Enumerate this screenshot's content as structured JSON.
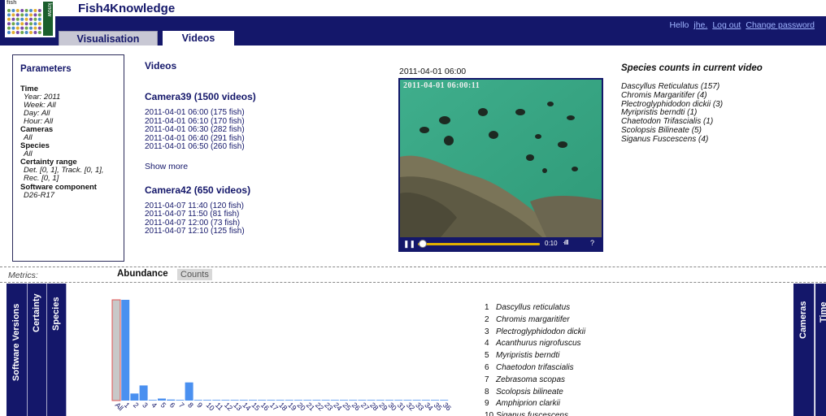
{
  "app": {
    "title": "Fish4Knowledge",
    "logo_top_text": "fish",
    "logo_side_text": "know"
  },
  "user": {
    "greeting": "Hello",
    "name": "jhe.",
    "logout": "Log out",
    "change_password": "Change password"
  },
  "tabs": [
    {
      "label": "Visualisation",
      "active": false
    },
    {
      "label": "Videos",
      "active": true
    }
  ],
  "parameters": {
    "title": "Parameters",
    "time_label": "Time",
    "year": "Year: 2011",
    "week": "Week: All",
    "day": "Day: All",
    "hour": "Hour: All",
    "cameras_label": "Cameras",
    "cameras_value": "All",
    "species_label": "Species",
    "species_value": "All",
    "certainty_label": "Certainty range",
    "certainty_line1": "Det. [0, 1], Track. [0, 1],",
    "certainty_line2": "Rec. [0, 1]",
    "software_label": "Software component",
    "software_value": "D26-R17"
  },
  "videos": {
    "title": "Videos",
    "show_more": "Show more",
    "cameras": [
      {
        "title": "Camera39 (1500 videos)",
        "items": [
          "2011-04-01 06:00 (175 fish)",
          "2011-04-01 06:10 (170 fish)",
          "2011-04-01 06:30 (282 fish)",
          "2011-04-01 06:40 (291 fish)",
          "2011-04-01 06:50 (260 fish)"
        ]
      },
      {
        "title": "Camera42 (650 videos)",
        "items": [
          "2011-04-07 11:40 (120 fish)",
          "2011-04-07 11:50 (81 fish)",
          "2011-04-07 12:00 (73 fish)",
          "2011-04-07 12:10 (125 fish)"
        ]
      }
    ]
  },
  "player": {
    "date": "2011-04-01 06:00",
    "overlay_timestamp": "2011-04-01 06:00:11",
    "time": "0:10",
    "progress": 0.02
  },
  "species_counts": {
    "title": "Species counts in current video",
    "items": [
      "Dascyllus Reticulatus (157)",
      "Chromis Margaritifer (4)",
      "Plectroglyphidodon dickii (3)",
      "Myripristis berndti (1)",
      "Chaetodon Trifascialis (1)",
      "Scolopsis Bilineate (5)",
      "Siganus Fuscescens (4)"
    ]
  },
  "metrics": {
    "label": "Metrics:",
    "tabs": [
      {
        "label": "Abundance",
        "active": true
      },
      {
        "label": "Counts",
        "active": false
      }
    ]
  },
  "side_tabs": {
    "left": [
      "Software Versions",
      "Certainty",
      "Species"
    ],
    "right": [
      "Cameras",
      "Time"
    ]
  },
  "legend": [
    {
      "num": "1",
      "name": "Dascyllus reticulatus"
    },
    {
      "num": "2",
      "name": "Chromis margaritifer"
    },
    {
      "num": "3",
      "name": "Plectroglyphidodon dickii"
    },
    {
      "num": "4",
      "name": "Acanthurus nigrofuscus"
    },
    {
      "num": "5",
      "name": "Myripristis berndti"
    },
    {
      "num": "6",
      "name": "Chaetodon trifascialis"
    },
    {
      "num": "7",
      "name": "Zebrasoma scopas"
    },
    {
      "num": "8",
      "name": "Scolopsis bilineate"
    },
    {
      "num": "9",
      "name": "Amphiprion clarkii"
    },
    {
      "num": "10",
      "name": "Siganus fuscescens"
    }
  ],
  "chart_data": {
    "type": "bar",
    "categories": [
      "All",
      "1",
      "2",
      "3",
      "4",
      "5",
      "6",
      "7",
      "8",
      "9",
      "10",
      "11",
      "12",
      "13",
      "14",
      "15",
      "16",
      "17",
      "18",
      "19",
      "20",
      "21",
      "22",
      "23",
      "24",
      "25",
      "26",
      "27",
      "28",
      "29",
      "30",
      "31",
      "32",
      "33",
      "34",
      "35",
      "36"
    ],
    "values": [
      100,
      100,
      7,
      15,
      0.5,
      2,
      1,
      0.5,
      18,
      0.3,
      0.5,
      0.3,
      0.2,
      0.2,
      0.2,
      0.2,
      0.2,
      0.2,
      0.2,
      0.2,
      0.2,
      0.2,
      0.2,
      0.2,
      0.2,
      0.2,
      0.2,
      0.2,
      0.2,
      0.2,
      0.2,
      0.2,
      0.2,
      0.2,
      0.2,
      0.2,
      0.2
    ],
    "ylim": [
      0,
      100
    ],
    "highlight_category": "All",
    "colors": {
      "bar": "#4a90f0",
      "highlight_fill": "#c8c8c8",
      "highlight_border": "#e05050",
      "tick_label": "#14176a"
    }
  }
}
